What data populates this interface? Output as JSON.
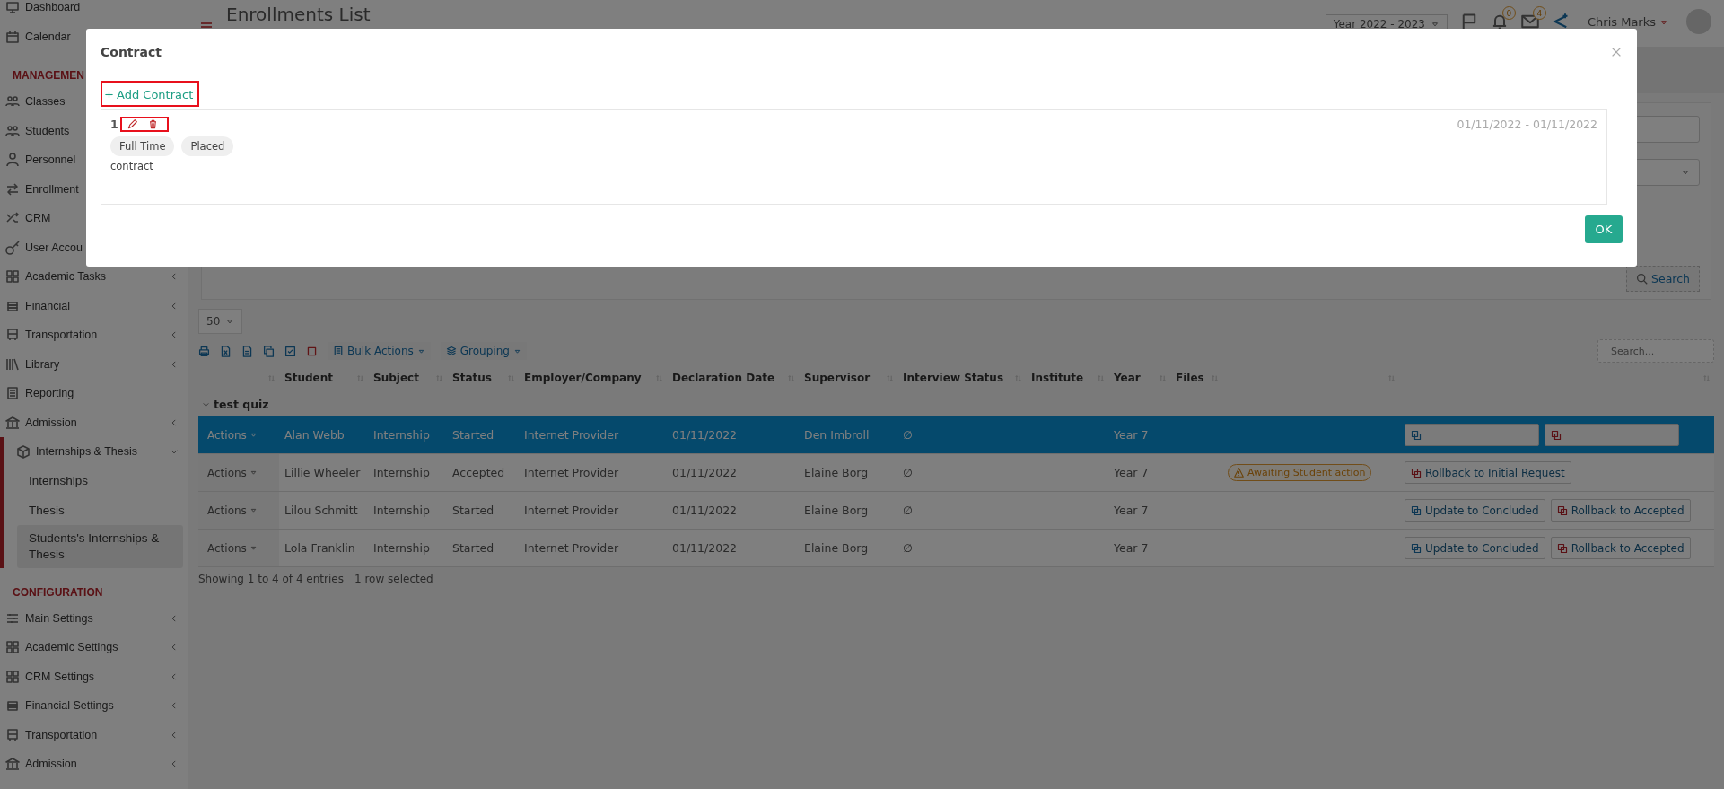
{
  "sidebar": {
    "items": [
      {
        "label": "Dashboard"
      },
      {
        "label": "Calendar"
      }
    ],
    "sections": [
      {
        "title": "MANAGEMEN",
        "items": [
          {
            "label": "Classes"
          },
          {
            "label": "Students"
          },
          {
            "label": "Personnel"
          },
          {
            "label": "Enrollment"
          },
          {
            "label": "CRM"
          },
          {
            "label": "User Accou"
          },
          {
            "label": "Academic Tasks",
            "expanded": false
          },
          {
            "label": "Financial",
            "expanded": false
          },
          {
            "label": "Transportation",
            "expanded": false
          },
          {
            "label": "Library",
            "expanded": false
          },
          {
            "label": "Reporting"
          },
          {
            "label": "Admission",
            "expanded": false
          },
          {
            "label": "Internships & Thesis",
            "expanded": true,
            "children": [
              {
                "label": "Internships",
                "selected": false
              },
              {
                "label": "Thesis",
                "selected": false
              },
              {
                "label": "Students's Internships & Thesis",
                "selected": true
              }
            ]
          }
        ]
      },
      {
        "title": "CONFIGURATION",
        "items": [
          {
            "label": "Main Settings",
            "expanded": false
          },
          {
            "label": "Academic Settings",
            "expanded": false
          },
          {
            "label": "CRM Settings",
            "expanded": false
          },
          {
            "label": "Financial Settings",
            "expanded": false
          },
          {
            "label": "Transportation",
            "expanded": false
          },
          {
            "label": "Admission",
            "expanded": false
          }
        ]
      }
    ]
  },
  "header": {
    "title": "Enrollments List",
    "year": "Year 2022 - 2023",
    "notifications": "0",
    "messages": "4",
    "user": "Chris Marks"
  },
  "filters": {
    "fields": [
      {
        "kind": "text"
      },
      {
        "kind": "select"
      }
    ],
    "search_button": "Search"
  },
  "table": {
    "page_size": "50",
    "bulk_actions": "Bulk Actions",
    "grouping": "Grouping",
    "search_placeholder": "Search...",
    "columns": [
      "Student",
      "Subject",
      "Status",
      "Employer/Company",
      "Declaration Date",
      "Supervisor",
      "Interview Status",
      "Institute",
      "Year",
      "Files"
    ],
    "group": "test quiz",
    "rows": [
      {
        "selected": true,
        "actions": "Actions",
        "student": "Alan Webb",
        "subject": "Internship",
        "status": "Started",
        "employer": "Internet Provider",
        "date": "01/11/2022",
        "supervisor": "Den Imbroll",
        "interview": "∅",
        "year": "Year 7",
        "buttons": [
          {
            "kind": "update"
          },
          {
            "kind": "rollback"
          }
        ]
      },
      {
        "selected": false,
        "actions": "Actions",
        "student": "Lillie Wheeler",
        "subject": "Internship",
        "status": "Accepted",
        "employer": "Internet Provider",
        "date": "01/11/2022",
        "supervisor": "Elaine Borg",
        "interview": "∅",
        "year": "Year 7",
        "badge": "Awaiting Student action",
        "buttons": [
          {
            "kind": "rollback",
            "label": "Rollback to Initial Request"
          }
        ]
      },
      {
        "selected": false,
        "actions": "Actions",
        "student": "Lilou Schmitt",
        "subject": "Internship",
        "status": "Started",
        "employer": "Internet Provider",
        "date": "01/11/2022",
        "supervisor": "Elaine Borg",
        "interview": "∅",
        "year": "Year 7",
        "buttons": [
          {
            "kind": "update",
            "label": "Update to Concluded"
          },
          {
            "kind": "rollback",
            "label": "Rollback to Accepted"
          }
        ]
      },
      {
        "selected": false,
        "actions": "Actions",
        "student": "Lola Franklin",
        "subject": "Internship",
        "status": "Started",
        "employer": "Internet Provider",
        "date": "01/11/2022",
        "supervisor": "Elaine Borg",
        "interview": "∅",
        "year": "Year 7",
        "buttons": [
          {
            "kind": "update",
            "label": "Update to Concluded"
          },
          {
            "kind": "rollback",
            "label": "Rollback to Accepted"
          }
        ]
      }
    ],
    "info": "Showing 1 to 4 of 4 entries",
    "selection": "1 row selected"
  },
  "modal": {
    "title": "Contract",
    "add_label": "Add Contract",
    "contracts": [
      {
        "number": "1",
        "period": "01/11/2022 - 01/11/2022",
        "tags": [
          "Full Time",
          "Placed"
        ],
        "note": "contract"
      }
    ],
    "ok": "OK"
  }
}
